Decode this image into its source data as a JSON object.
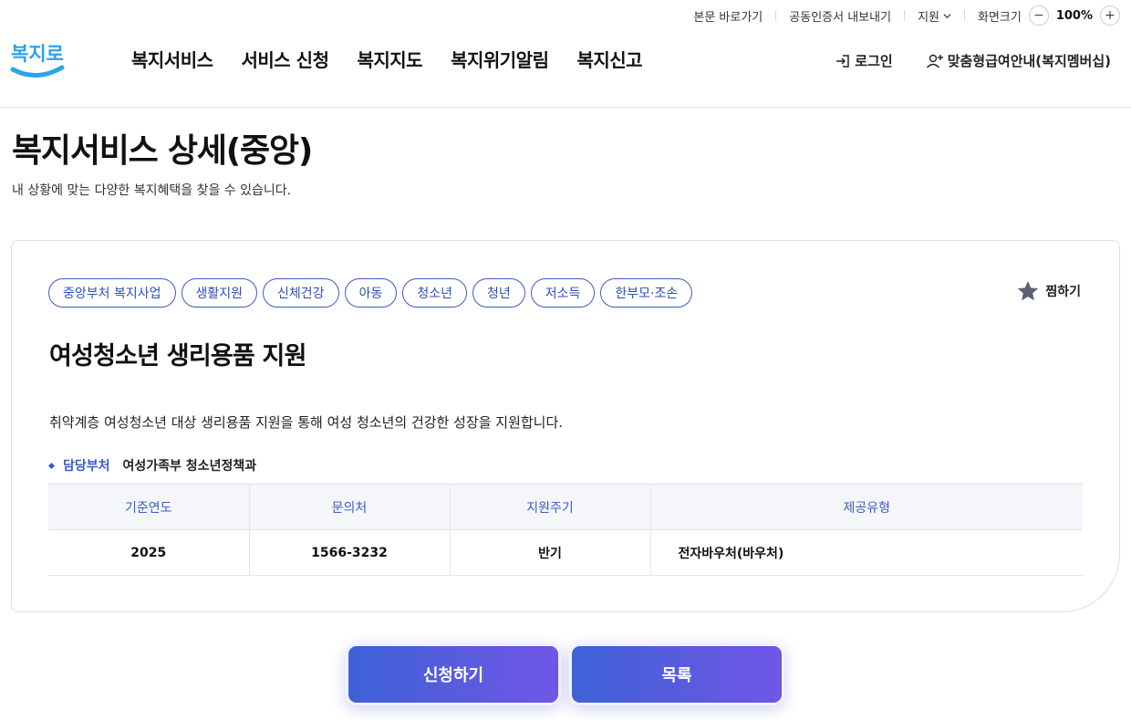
{
  "utility": {
    "skip_link": "본문 바로가기",
    "cert_export": "공동인증서 내보내기",
    "support": "지원",
    "zoom_label": "화면크기",
    "zoom_value": "100%",
    "zoom_minus": "−",
    "zoom_plus": "+"
  },
  "header": {
    "logo_text": "복지로",
    "nav": [
      "복지서비스",
      "서비스 신청",
      "복지지도",
      "복지위기알림",
      "복지신고"
    ],
    "login": "로그인",
    "membership": "맞춤형급여안내(복지멤버십)"
  },
  "page": {
    "title": "복지서비스 상세(중앙)",
    "subtitle": "내 상황에 맞는 다양한 복지혜택을 찾을 수 있습니다."
  },
  "service": {
    "tags": [
      "중앙부처 복지사업",
      "생활지원",
      "신체건강",
      "아동",
      "청소년",
      "청년",
      "저소득",
      "한부모·조손"
    ],
    "favorite_label": "찜하기",
    "title": "여성청소년 생리용품 지원",
    "description": "취약계층 여성청소년 대상 생리용품 지원을 통해 여성 청소년의 건강한 성장을 지원합니다.",
    "dept_label": "담당부처",
    "dept_value": "여성가족부 청소년정책과",
    "table": {
      "headers": [
        "기준연도",
        "문의처",
        "지원주기",
        "제공유형"
      ],
      "row": [
        "2025",
        "1566-3232",
        "반기",
        "전자바우처(바우처)"
      ]
    }
  },
  "buttons": {
    "apply": "신청하기",
    "list": "목록"
  },
  "colors": {
    "accent": "#3d5bc4",
    "logo_blue": "#2aa4e8",
    "button_gradient_start": "#3d62d6",
    "button_gradient_end": "#7056e6"
  }
}
